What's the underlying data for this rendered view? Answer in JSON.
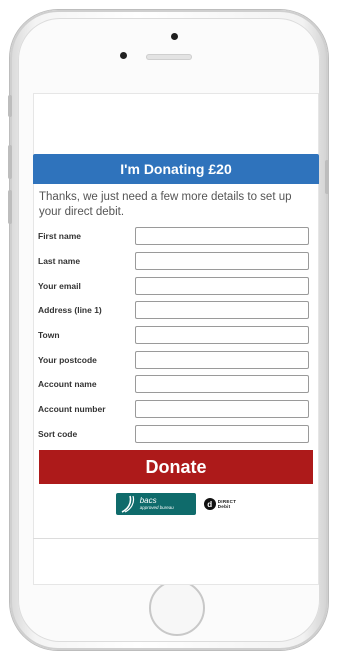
{
  "header": {
    "title": "I'm Donating £20"
  },
  "intro": {
    "text": "Thanks, we just need a few more details to set up your direct debit."
  },
  "form": {
    "fields": [
      {
        "label": "First name",
        "value": ""
      },
      {
        "label": "Last name",
        "value": ""
      },
      {
        "label": "Your email",
        "value": ""
      },
      {
        "label": "Address (line 1)",
        "value": ""
      },
      {
        "label": "Town",
        "value": ""
      },
      {
        "label": "Your postcode",
        "value": ""
      },
      {
        "label": "Account name",
        "value": ""
      },
      {
        "label": "Account number",
        "value": ""
      },
      {
        "label": "Sort code",
        "value": ""
      }
    ]
  },
  "donate_button": {
    "label": "Donate"
  },
  "logos": {
    "bacs": {
      "line1": "bacs",
      "line2": "approved bureau"
    },
    "direct_debit": {
      "line1": "DIRECT",
      "line2": "Debit"
    }
  },
  "colors": {
    "header": "#2f73bc",
    "donate": "#ad1a1a",
    "bacs": "#0f6b6b"
  }
}
